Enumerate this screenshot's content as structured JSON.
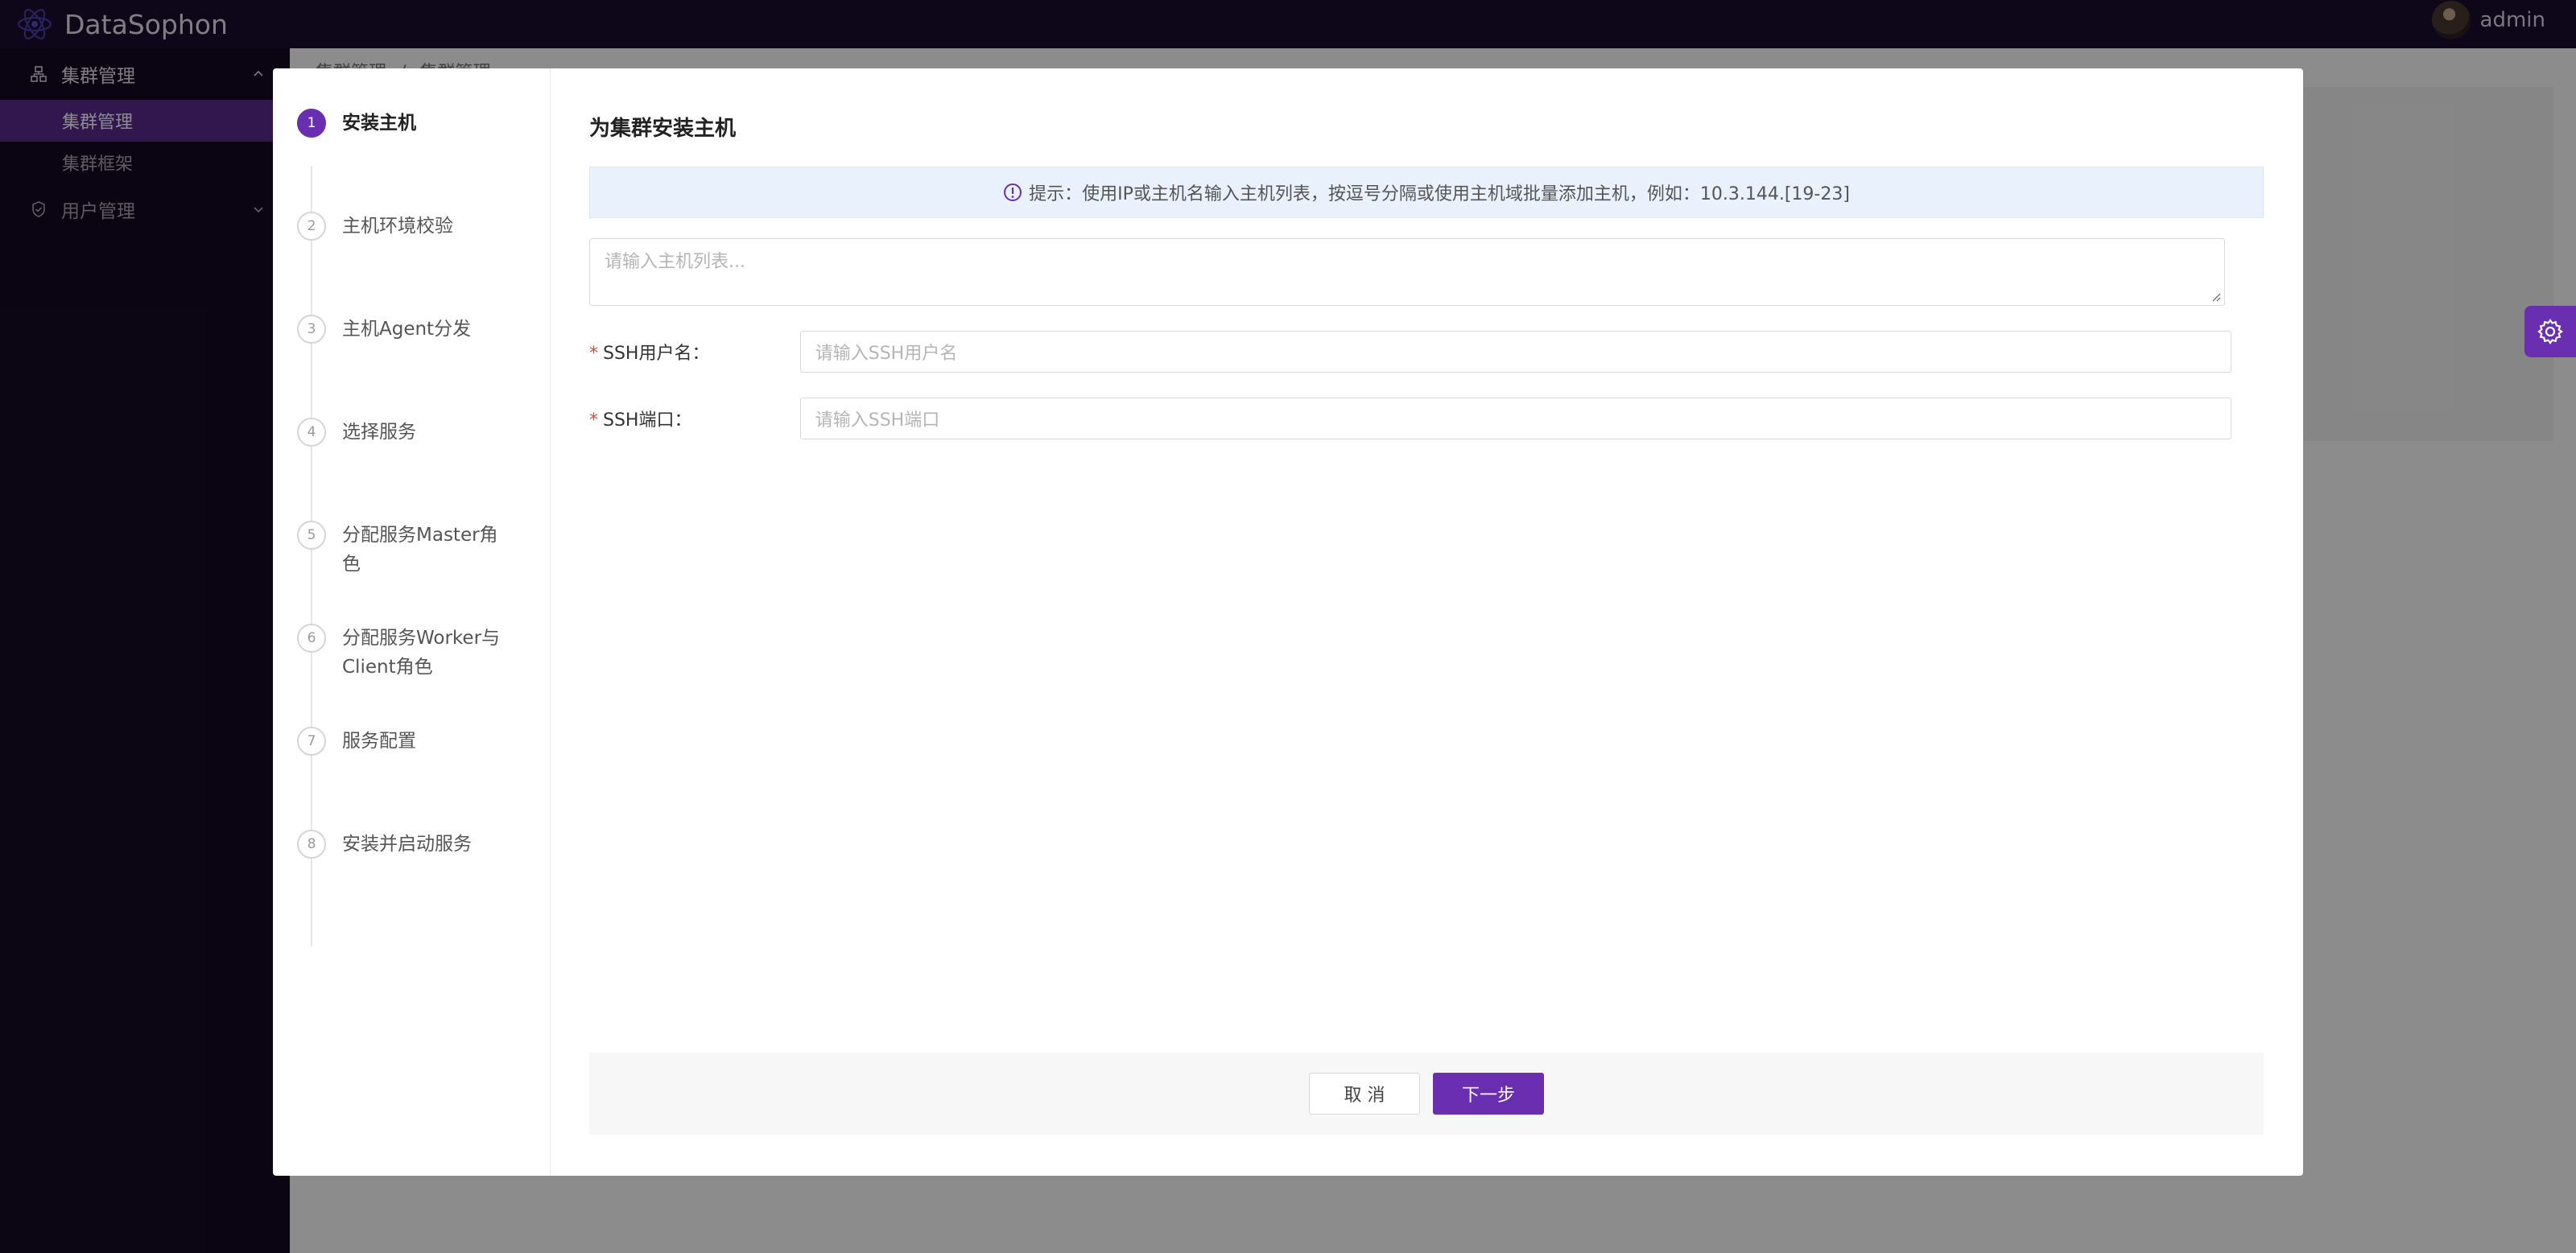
{
  "app": {
    "name": "DataSophon"
  },
  "user": {
    "name": "admin"
  },
  "sidebar": {
    "groups": [
      {
        "label": "集群管理",
        "items": [
          {
            "label": "集群管理",
            "active": true
          },
          {
            "label": "集群框架",
            "active": false
          }
        ]
      },
      {
        "label": "用户管理",
        "items": []
      }
    ]
  },
  "breadcrumb": {
    "items": [
      "集群管理",
      "集群管理"
    ],
    "separator": "/"
  },
  "wizard": {
    "steps": [
      {
        "num": "1",
        "label": "安装主机"
      },
      {
        "num": "2",
        "label": "主机环境校验"
      },
      {
        "num": "3",
        "label": "主机Agent分发"
      },
      {
        "num": "4",
        "label": "选择服务"
      },
      {
        "num": "5",
        "label": "分配服务Master角色"
      },
      {
        "num": "6",
        "label": "分配服务Worker与Client角色"
      },
      {
        "num": "7",
        "label": "服务配置"
      },
      {
        "num": "8",
        "label": "安装并启动服务"
      }
    ],
    "active_step": 1
  },
  "main": {
    "title": "为集群安装主机",
    "alert": "提示：使用IP或主机名输入主机列表，按逗号分隔或使用主机域批量添加主机，例如：10.3.144.[19-23]",
    "hosts_placeholder": "请输入主机列表...",
    "ssh_user_label": "SSH用户名：",
    "ssh_user_placeholder": "请输入SSH用户名",
    "ssh_port_label": "SSH端口：",
    "ssh_port_placeholder": "请输入SSH端口",
    "required_mark": "*"
  },
  "footer": {
    "cancel_label": "取 消",
    "next_label": "下一步"
  },
  "colors": {
    "accent": "#6a2fb0",
    "header": "#1b0b2e",
    "sidebar": "#150a24"
  }
}
